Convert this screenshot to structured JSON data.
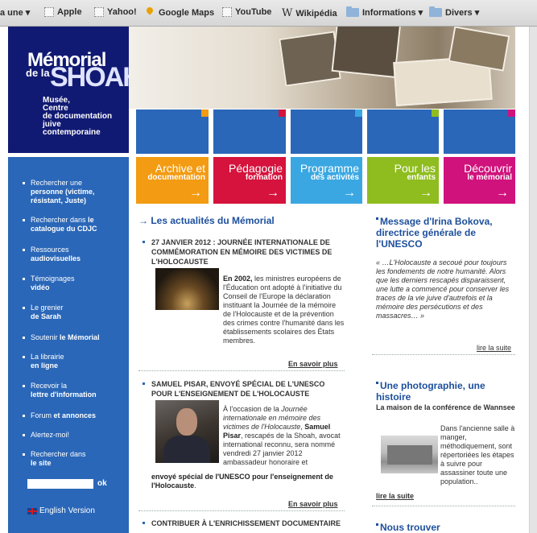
{
  "bookmarks": {
    "items": [
      {
        "label": "a une ▾",
        "icon": "none"
      },
      {
        "label": "Apple",
        "icon": "page-icon"
      },
      {
        "label": "Yahoo!",
        "icon": "page-icon"
      },
      {
        "label": "Google Maps",
        "icon": "google-maps-icon"
      },
      {
        "label": "YouTube",
        "icon": "page-icon"
      },
      {
        "label": "Wikipédia",
        "icon": "wikipedia-icon"
      },
      {
        "label": "Informations ▾",
        "icon": "folder-icon"
      },
      {
        "label": "Divers ▾",
        "icon": "folder-icon"
      }
    ],
    "wikipedia_glyph": "W"
  },
  "logo": {
    "line1": "Mémorial",
    "line2": "de la",
    "line3": "SHOAH",
    "subtitle": [
      "Musée,",
      "Centre",
      "de documentation",
      "juive",
      "contemporaine"
    ]
  },
  "categories": [
    {
      "title": "Archive et",
      "subtitle": "documentation",
      "color": "#f39b12"
    },
    {
      "title": "Pédagogie",
      "subtitle": "formation",
      "color": "#d5133c"
    },
    {
      "title": "Programme",
      "subtitle": "des activités",
      "color": "#3aa7e2"
    },
    {
      "title": "Pour les",
      "subtitle": "enfants",
      "color": "#8fbd1f"
    },
    {
      "title": "Découvrir",
      "subtitle": "le mémorial",
      "color": "#d0127c"
    }
  ],
  "tile_corner_colors": [
    "#f39b12",
    "#d5133c",
    "#3aa7e2",
    "#8fbd1f",
    "#d0127c"
  ],
  "arrow_glyph": "→",
  "sidebar": {
    "items": [
      {
        "normal": "Rechercher une",
        "bold": "personne (victime, résistant, Juste)"
      },
      {
        "normal": "Rechercher dans",
        "bold": "le catalogue du CDJC"
      },
      {
        "normal": "Ressources",
        "bold": "audiovisuelles"
      },
      {
        "normal": "Témoignages",
        "bold": "vidéo"
      },
      {
        "normal": "Le grenier",
        "bold": "de Sarah"
      },
      {
        "normal": "Soutenir",
        "bold": "le Mémorial"
      },
      {
        "normal": "La librairie",
        "bold": "en ligne"
      },
      {
        "normal": "Recevoir la",
        "bold": "lettre d'information"
      },
      {
        "normal": "Forum",
        "bold": "et annonces"
      },
      {
        "normal": "Alertez-moi!",
        "bold": ""
      },
      {
        "normal": "Rechercher dans",
        "bold": "le site"
      }
    ],
    "search_value": "",
    "ok_label": "ok",
    "english_label": "English Version"
  },
  "news": {
    "section_title": "Les actualités du Mémorial",
    "articles": [
      {
        "title": "27 JANVIER 2012 : JOURNÉE INTERNATIONALE DE COMMÉMORATION EN MÉMOIRE DES VICTIMES DE L'HOLOCAUSTE",
        "lead_bold": "En 2002,",
        "text": " les ministres européens de l'Éducation ont adopté à l'initiative du Conseil de l'Europe la déclaration instituant la Journée de la mémoire de l'Holocauste et de la prévention des crimes contre l'humanité dans les établissements scolaires des États membres.",
        "more": "En savoir plus"
      },
      {
        "title": "SAMUEL PISAR, ENVOYÉ SPÉCIAL DE L'UNESCO POUR L'ENSEIGNEMENT DE L'HOLOCAUSTE",
        "text_a": "À l'occasion de la ",
        "text_italic": "Journée internationale en mémoire des victimes de l'Holocauste",
        "text_b": ", ",
        "name_bold": "Samuel Pisar",
        "text_c": ", rescapés de la Shoah, avocat international reconnu, sera nommé vendredi 27 janvier 2012 ambassadeur honoraire et ",
        "tail_bold": "envoyé spécial de l'UNESCO pour l'enseignement de l'Holocauste",
        "tail_end": ".",
        "more": "En savoir plus"
      },
      {
        "title": "CONTRIBUER À L'ENRICHISSEMENT DOCUMENTAIRE"
      }
    ]
  },
  "right": {
    "message": {
      "title": "Message d'Irina Bokova, directrice générale de l'UNESCO",
      "quote": "« …L'Holocauste a secoué pour toujours les fondements de notre humanité. Alors que les derniers rescapés disparaissent, une lutte a commencé pour conserver les traces de la vie juive d'autrefois et la mémoire des persécutions et des massacres… »",
      "link": "lire la suite"
    },
    "photo": {
      "title": "Une photographie, une histoire",
      "subtitle": "La maison de la conférence de Wannsee",
      "text": "Dans l'ancienne salle à manger, méthodiquement, sont répertoriées les étapes à suivre pour assassiner toute une population..",
      "link": "lire la suite"
    },
    "find": {
      "title": "Nous trouver"
    }
  }
}
